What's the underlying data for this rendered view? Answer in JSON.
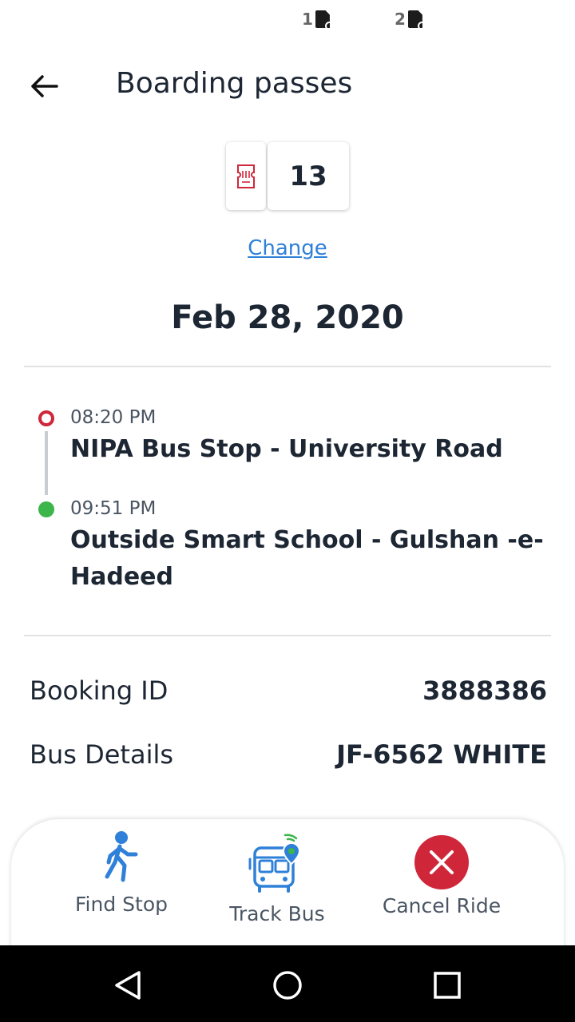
{
  "status_bar": {
    "sim1_label": "1",
    "sim2_label": "2"
  },
  "header": {
    "title": "Boarding passes",
    "back_icon": "arrow-left-icon"
  },
  "seat": {
    "icon": "ticket-icon",
    "number": "13",
    "change_label": "Change"
  },
  "trip": {
    "date": "Feb 28, 2020",
    "origin": {
      "time": "08:20 PM",
      "name": "NIPA Bus Stop - University Road"
    },
    "destination": {
      "time": "09:51 PM",
      "name": "Outside Smart School - Gulshan -e-Hadeed"
    }
  },
  "details": {
    "booking_label": "Booking ID",
    "booking_value": "3888386",
    "bus_label": "Bus Details",
    "bus_value": "JF-6562 WHITE"
  },
  "actions": {
    "find_stop": {
      "label": "Find Stop",
      "icon": "walking-person-icon"
    },
    "track_bus": {
      "label": "Track Bus",
      "icon": "bus-location-icon"
    },
    "cancel_ride": {
      "label": "Cancel Ride",
      "icon": "close-icon"
    }
  },
  "nav": {
    "back_icon": "nav-back-icon",
    "home_icon": "nav-home-icon",
    "recents_icon": "nav-recents-icon"
  },
  "colors": {
    "accent_red": "#d0263a",
    "accent_green": "#3cb54a",
    "link_blue": "#2f80d8",
    "icon_blue": "#2f80d8",
    "text_dark": "#1d2633"
  }
}
